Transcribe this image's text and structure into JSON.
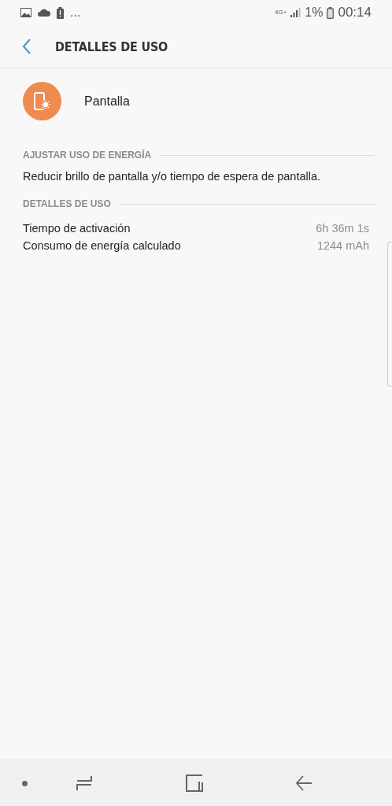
{
  "status_bar": {
    "more": "...",
    "network": "4G+",
    "battery": "1%",
    "time": "00:14"
  },
  "header": {
    "title": "DETALLES DE USO"
  },
  "app": {
    "name": "Pantalla"
  },
  "sections": [
    {
      "kind": "text",
      "title": "AJUSTAR USO DE ENERGÍA",
      "text": "Reducir brillo de pantalla y/o tiempo de espera de pantalla."
    },
    {
      "kind": "rows",
      "title": "DETALLES DE USO",
      "rows": [
        {
          "label": "Tiempo de activación",
          "value": "6h 36m 1s"
        },
        {
          "label": "Consumo de energía calculado",
          "value": "1244 mAh"
        }
      ]
    }
  ]
}
